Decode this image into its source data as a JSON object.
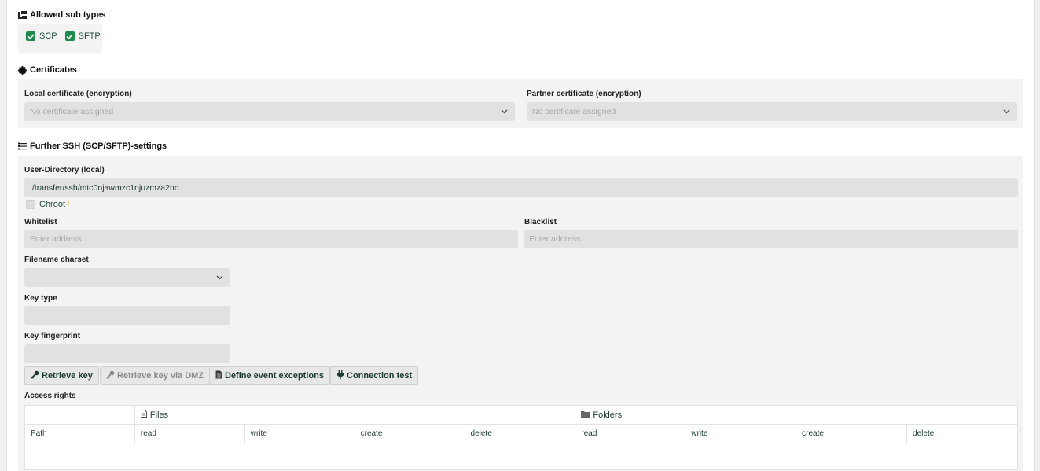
{
  "allowed_sub_types": {
    "title": "Allowed sub types",
    "options": [
      {
        "label": "SCP",
        "checked": true
      },
      {
        "label": "SFTP",
        "checked": true
      }
    ]
  },
  "certificates": {
    "title": "Certificates",
    "local_label": "Local certificate (encryption)",
    "local_value": "No certificate assigned",
    "partner_label": "Partner certificate (encryption)",
    "partner_value": "No certificate assigned"
  },
  "ssh_settings": {
    "title": "Further SSH (SCP/SFTP)-settings",
    "user_dir_label": "User-Directory (local)",
    "user_dir_value": "./transfer/ssh/mtc0njawmzc1njuzmza2nq",
    "chroot_label": "Chroot",
    "chroot_info": "i",
    "whitelist_label": "Whitelist",
    "whitelist_placeholder": "Enter address...",
    "blacklist_label": "Blacklist",
    "blacklist_placeholder": "Enter address...",
    "charset_label": "Filename charset",
    "charset_value": "",
    "key_type_label": "Key type",
    "key_type_value": "",
    "key_fp_label": "Key fingerprint",
    "key_fp_value": ""
  },
  "buttons": {
    "retrieve_key": "Retrieve key",
    "retrieve_key_dmz": "Retrieve key via DMZ",
    "define_exceptions": "Define event exceptions",
    "connection_test": "Connection test"
  },
  "access_rights": {
    "title": "Access rights",
    "files_label": "Files",
    "folders_label": "Folders",
    "columns": [
      "Path",
      "read",
      "write",
      "create",
      "delete",
      "read",
      "write",
      "create",
      "delete"
    ]
  },
  "colors": {
    "accent": "#1f8a4c",
    "field_bg": "#e1e1e1",
    "section_bg": "#f3f3f3"
  }
}
